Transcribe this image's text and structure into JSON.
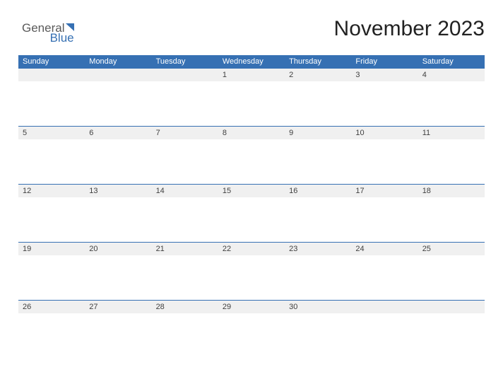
{
  "logo": {
    "word1": "General",
    "word2": "Blue"
  },
  "title": "November 2023",
  "daysOfWeek": [
    "Sunday",
    "Monday",
    "Tuesday",
    "Wednesday",
    "Thursday",
    "Friday",
    "Saturday"
  ],
  "weeks": [
    [
      "",
      "",
      "",
      "1",
      "2",
      "3",
      "4"
    ],
    [
      "5",
      "6",
      "7",
      "8",
      "9",
      "10",
      "11"
    ],
    [
      "12",
      "13",
      "14",
      "15",
      "16",
      "17",
      "18"
    ],
    [
      "19",
      "20",
      "21",
      "22",
      "23",
      "24",
      "25"
    ],
    [
      "26",
      "27",
      "28",
      "29",
      "30",
      "",
      ""
    ]
  ]
}
